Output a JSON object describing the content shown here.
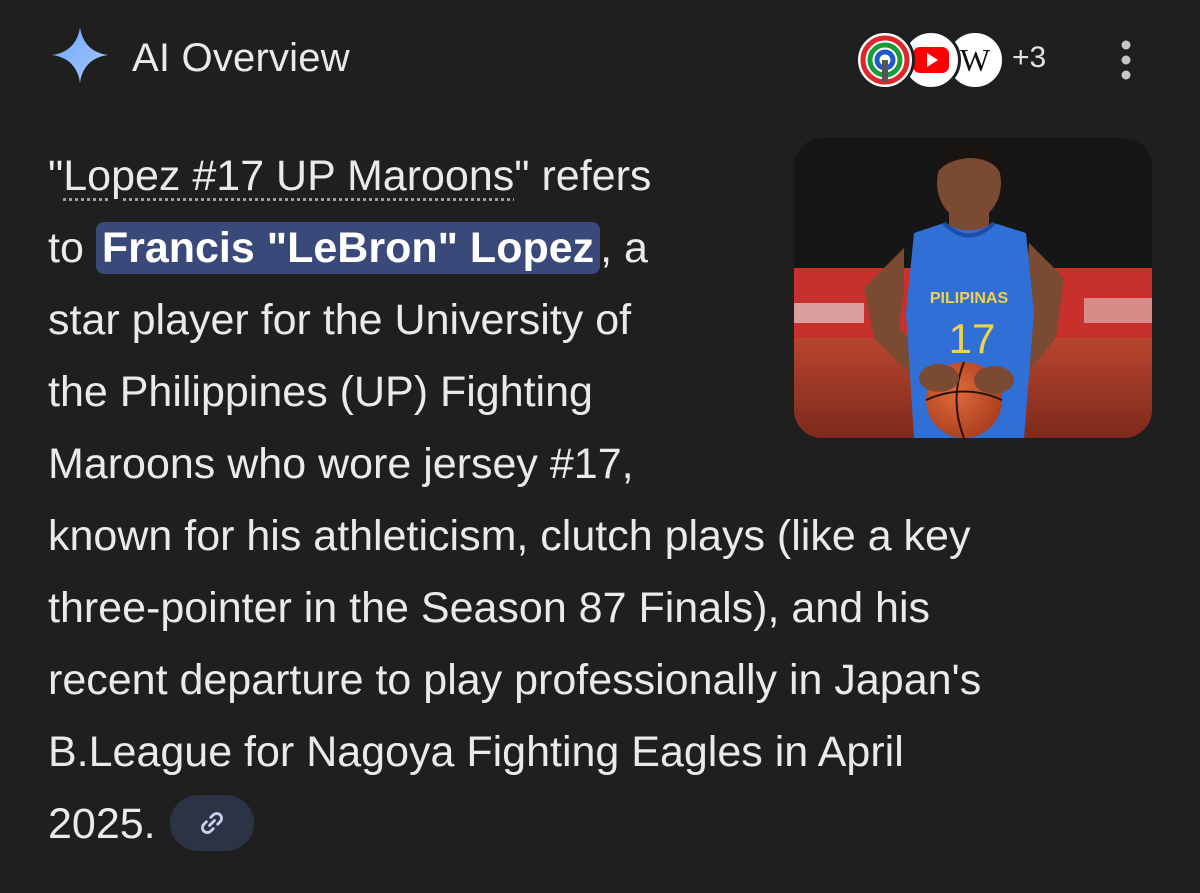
{
  "header": {
    "title": "AI Overview",
    "icon": "sparkle-icon",
    "accent_color": "#8ab4f8",
    "sources": [
      {
        "name": "ABS-CBN",
        "icon": "abs-cbn-logo-icon"
      },
      {
        "name": "YouTube",
        "icon": "youtube-logo-icon"
      },
      {
        "name": "Wikipedia",
        "icon": "wikipedia-logo-icon",
        "text": "W"
      }
    ],
    "more_sources_count": "+3",
    "menu_icon": "more-vert-icon"
  },
  "thumbnail": {
    "icon": "player-photo-image",
    "jersey_text": "PILIPINAS",
    "jersey_number": "17"
  },
  "answer": {
    "line1_quote_open": "\"",
    "line1_link": "Lopez #17 UP Maroons",
    "line1_rest": "\" refers",
    "line2_pre": "to ",
    "line2_highlight": "Francis \"LeBron\" Lopez",
    "line2_post": ", a",
    "line3": "star player for the University of",
    "line4": "the Philippines (UP) Fighting",
    "line5": "Maroons who wore jersey #17,",
    "line6": "known for his athleticism, clutch plays (like a key",
    "line7": "three-pointer in the Season 87 Finals), and his",
    "line8": "recent departure to play professionally in Japan's",
    "line9": "B.League for Nagoya Fighting Eagles in April",
    "line10": "2025.",
    "link_chip_icon": "link-icon"
  },
  "colors": {
    "background": "#1f1f1f",
    "highlight": "#394a7a",
    "text": "#e8eaed"
  }
}
